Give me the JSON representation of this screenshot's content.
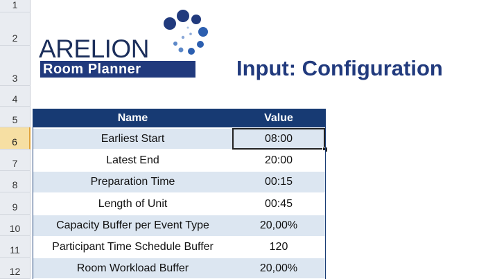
{
  "row_headers": [
    "1",
    "2",
    "3",
    "4",
    "5",
    "6",
    "7",
    "8",
    "9",
    "10",
    "11",
    "12"
  ],
  "logo": {
    "brand": "ARELION",
    "subtitle": "Room Planner"
  },
  "title": "Input: Configuration",
  "table": {
    "headers": {
      "name": "Name",
      "value": "Value"
    },
    "rows": [
      {
        "name": "Earliest Start",
        "value": "08:00"
      },
      {
        "name": "Latest End",
        "value": "20:00"
      },
      {
        "name": "Preparation Time",
        "value": "00:15"
      },
      {
        "name": "Length of Unit",
        "value": "00:45"
      },
      {
        "name": "Capacity Buffer per Event Type",
        "value": "20,00%"
      },
      {
        "name": "Participant Time Schedule Buffer",
        "value": "120"
      },
      {
        "name": "Room Workload Buffer",
        "value": "20,00%"
      }
    ]
  },
  "colors": {
    "header": "#173a73",
    "band": "#dce6f1",
    "selected_row_header": "#f6dfa3",
    "title": "#213a7d"
  }
}
